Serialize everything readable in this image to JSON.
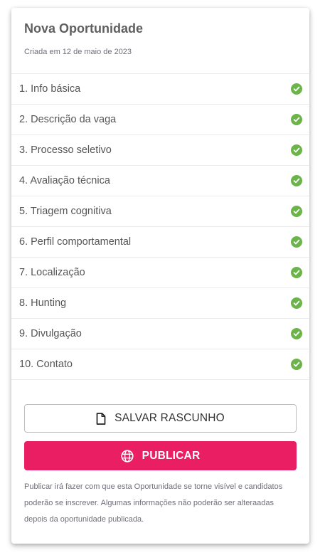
{
  "header": {
    "title": "Nova Oportunidade",
    "created": "Criada em 12 de maio de 2023"
  },
  "steps": [
    {
      "label": "1. Info básica",
      "status": "complete"
    },
    {
      "label": "2. Descrição da vaga",
      "status": "complete"
    },
    {
      "label": "3. Processo seletivo",
      "status": "complete"
    },
    {
      "label": "4. Avaliação técnica",
      "status": "complete"
    },
    {
      "label": "5. Triagem cognitiva",
      "status": "complete"
    },
    {
      "label": "6. Perfil comportamental",
      "status": "complete"
    },
    {
      "label": "7. Localização",
      "status": "complete"
    },
    {
      "label": "8. Hunting",
      "status": "complete"
    },
    {
      "label": "9. Divulgação",
      "status": "complete"
    },
    {
      "label": "10. Contato",
      "status": "complete"
    }
  ],
  "actions": {
    "save_draft_label": "SALVAR RASCUNHO",
    "save_draft_icon": "file-icon",
    "publish_label": "PUBLICAR",
    "publish_icon": "globe-icon",
    "note": "Publicar irá fazer com que esta Oportunidade se torne visível e candidatos poderão se inscrever. Algumas informações não poderão ser alteraadas depois da oportunidade publicada."
  },
  "colors": {
    "accent": "#e91e63",
    "check": "#6bb44a"
  }
}
